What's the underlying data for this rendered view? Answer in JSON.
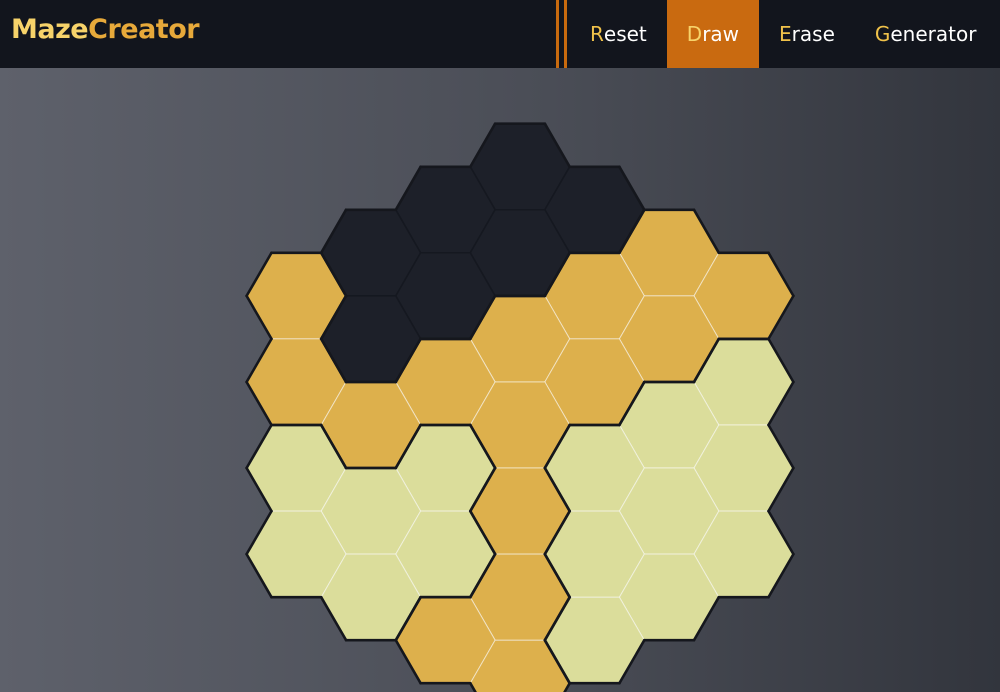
{
  "app": {
    "title_part1": "Maze",
    "title_part2": "Creator"
  },
  "nav": [
    {
      "first": "R",
      "rest": "eset",
      "active": false
    },
    {
      "first": "D",
      "rest": "raw",
      "active": true
    },
    {
      "first": "E",
      "rest": "rase",
      "active": false
    },
    {
      "first": "G",
      "rest": "enerator",
      "active": false
    }
  ],
  "colors": {
    "wall": "#1d2029",
    "path": "#ddb04c",
    "open": "#dbdd9b",
    "accent": "#c96a10"
  },
  "grid": {
    "radius": 3,
    "cells": [
      {
        "q": 0,
        "r": -3,
        "state": "wall"
      },
      {
        "q": 1,
        "r": -3,
        "state": "wall"
      },
      {
        "q": 2,
        "r": -3,
        "state": "path"
      },
      {
        "q": 3,
        "r": -3,
        "state": "path"
      },
      {
        "q": -1,
        "r": -2,
        "state": "wall"
      },
      {
        "q": 0,
        "r": -2,
        "state": "wall"
      },
      {
        "q": 1,
        "r": -2,
        "state": "path"
      },
      {
        "q": 2,
        "r": -2,
        "state": "path"
      },
      {
        "q": 3,
        "r": -2,
        "state": "open"
      },
      {
        "q": -2,
        "r": -1,
        "state": "wall"
      },
      {
        "q": -1,
        "r": -1,
        "state": "wall"
      },
      {
        "q": 0,
        "r": -1,
        "state": "path"
      },
      {
        "q": 1,
        "r": -1,
        "state": "path"
      },
      {
        "q": 2,
        "r": -1,
        "state": "open"
      },
      {
        "q": 3,
        "r": -1,
        "state": "open"
      },
      {
        "q": -3,
        "r": 0,
        "state": "path"
      },
      {
        "q": -2,
        "r": 0,
        "state": "wall"
      },
      {
        "q": -1,
        "r": 0,
        "state": "path"
      },
      {
        "q": 0,
        "r": 0,
        "state": "path"
      },
      {
        "q": 1,
        "r": 0,
        "state": "open"
      },
      {
        "q": 2,
        "r": 0,
        "state": "open"
      },
      {
        "q": 3,
        "r": 0,
        "state": "open"
      },
      {
        "q": -3,
        "r": 1,
        "state": "path"
      },
      {
        "q": -2,
        "r": 1,
        "state": "path"
      },
      {
        "q": -1,
        "r": 1,
        "state": "open"
      },
      {
        "q": 0,
        "r": 1,
        "state": "path"
      },
      {
        "q": 1,
        "r": 1,
        "state": "open"
      },
      {
        "q": 2,
        "r": 1,
        "state": "open"
      },
      {
        "q": -3,
        "r": 2,
        "state": "open"
      },
      {
        "q": -2,
        "r": 2,
        "state": "open"
      },
      {
        "q": -1,
        "r": 2,
        "state": "open"
      },
      {
        "q": 0,
        "r": 2,
        "state": "path"
      },
      {
        "q": 1,
        "r": 2,
        "state": "open"
      },
      {
        "q": -3,
        "r": 3,
        "state": "open"
      },
      {
        "q": -2,
        "r": 3,
        "state": "open"
      },
      {
        "q": -1,
        "r": 3,
        "state": "path"
      },
      {
        "q": 0,
        "r": 3,
        "state": "path"
      }
    ]
  }
}
